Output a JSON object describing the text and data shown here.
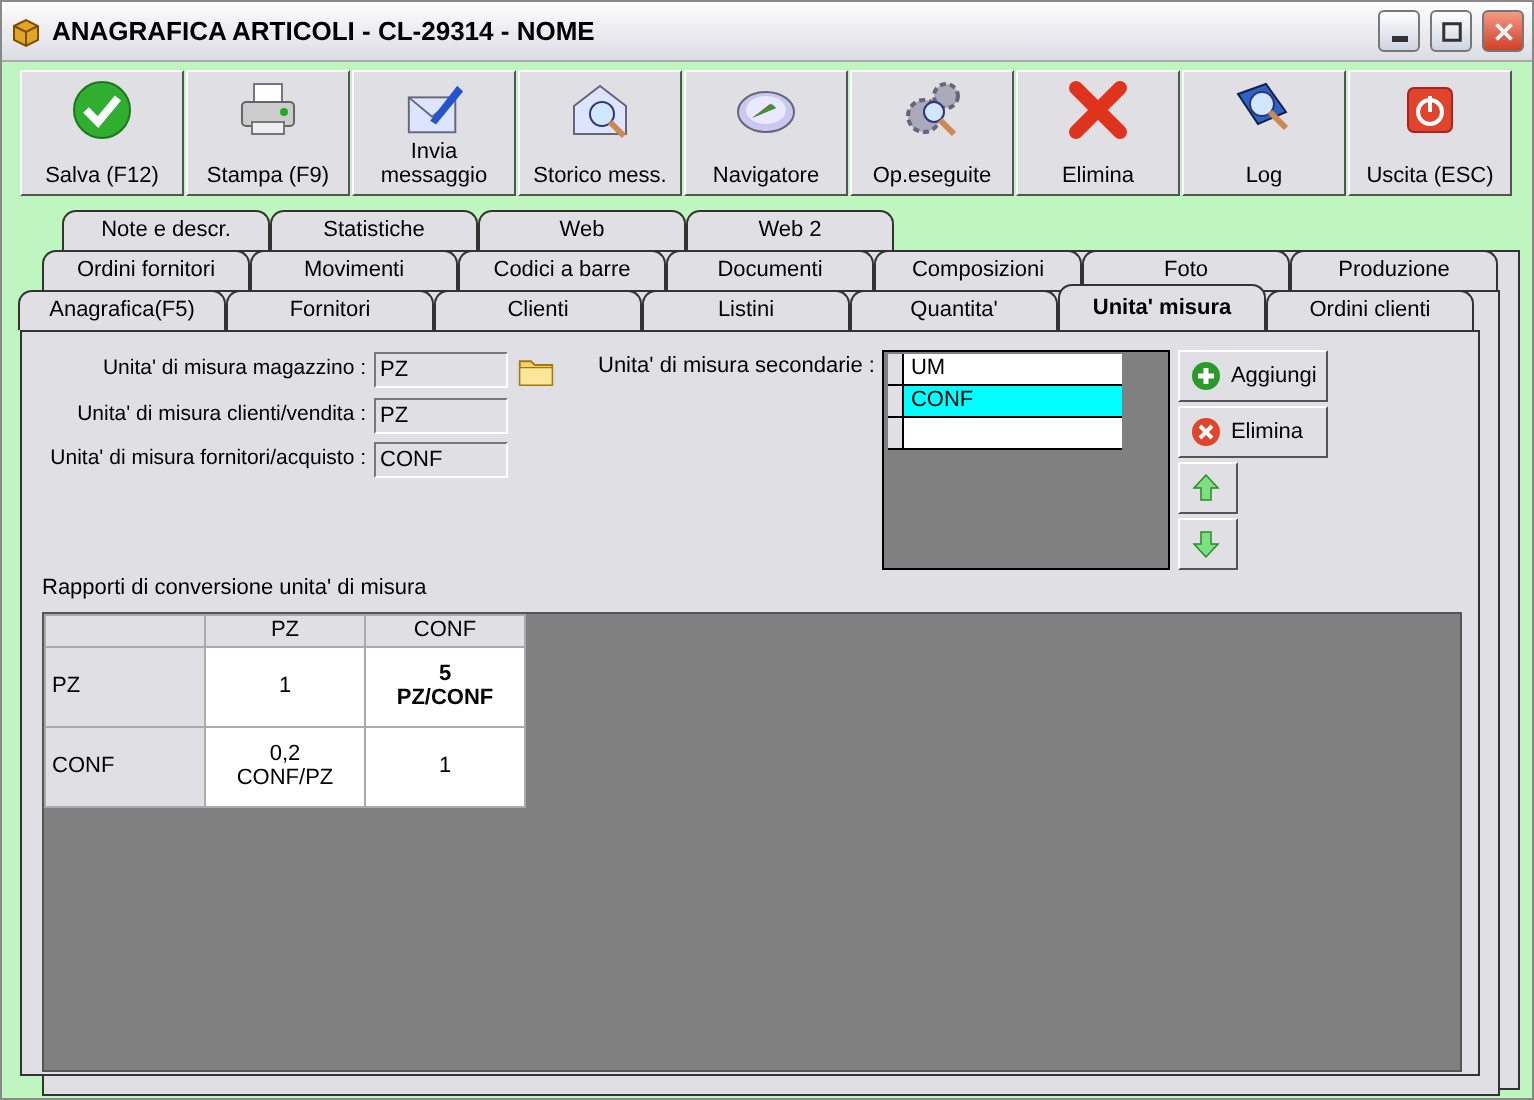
{
  "window": {
    "title": "ANAGRAFICA ARTICOLI - CL-29314 - NOME"
  },
  "toolbar": [
    {
      "label": "Salva (F12)"
    },
    {
      "label": "Stampa (F9)"
    },
    {
      "label": "Invia messaggio"
    },
    {
      "label": "Storico mess."
    },
    {
      "label": "Navigatore"
    },
    {
      "label": "Op.eseguite"
    },
    {
      "label": "Elimina"
    },
    {
      "label": "Log"
    },
    {
      "label": "Uscita (ESC)"
    }
  ],
  "tab_rows": [
    [
      {
        "label": "Note e descr.",
        "selected": false
      },
      {
        "label": "Statistiche",
        "selected": false
      },
      {
        "label": "Web",
        "selected": false
      },
      {
        "label": "Web 2",
        "selected": false
      }
    ],
    [
      {
        "label": "Ordini fornitori",
        "selected": false
      },
      {
        "label": "Movimenti",
        "selected": false
      },
      {
        "label": "Codici a barre",
        "selected": false
      },
      {
        "label": "Documenti",
        "selected": false
      },
      {
        "label": "Composizioni",
        "selected": false
      },
      {
        "label": "Foto",
        "selected": false
      },
      {
        "label": "Produzione",
        "selected": false
      }
    ],
    [
      {
        "label": "Anagrafica(F5)",
        "selected": false
      },
      {
        "label": "Fornitori",
        "selected": false
      },
      {
        "label": "Clienti",
        "selected": false
      },
      {
        "label": "Listini",
        "selected": false
      },
      {
        "label": "Quantita'",
        "selected": false
      },
      {
        "label": "Unita' misura",
        "selected": true
      },
      {
        "label": "Ordini clienti",
        "selected": false
      }
    ]
  ],
  "fields": [
    {
      "label": "Unita' di misura magazzino :",
      "value": "PZ"
    },
    {
      "label": "Unita' di misura clienti/vendita :",
      "value": "PZ"
    },
    {
      "label": "Unita' di misura fornitori/acquisto :",
      "value": "CONF"
    }
  ],
  "secondary": {
    "label": "Unita' di misura secondarie :",
    "rows": [
      {
        "text": "UM",
        "selected": false
      },
      {
        "text": "CONF",
        "selected": true
      }
    ],
    "buttons": [
      "Aggiungi",
      "Elimina"
    ]
  },
  "conversion": {
    "title": "Rapporti di conversione unita' di misura",
    "columns": [
      "PZ",
      "CONF"
    ],
    "rows": [
      {
        "header": "PZ",
        "cells": [
          {
            "lines": [
              "1"
            ],
            "bold": false
          },
          {
            "lines": [
              "5",
              "PZ/CONF"
            ],
            "bold": true
          }
        ]
      },
      {
        "header": "CONF",
        "cells": [
          {
            "lines": [
              "0,2",
              "CONF/PZ"
            ],
            "bold": false
          },
          {
            "lines": [
              "1"
            ],
            "bold": false
          }
        ]
      }
    ]
  }
}
